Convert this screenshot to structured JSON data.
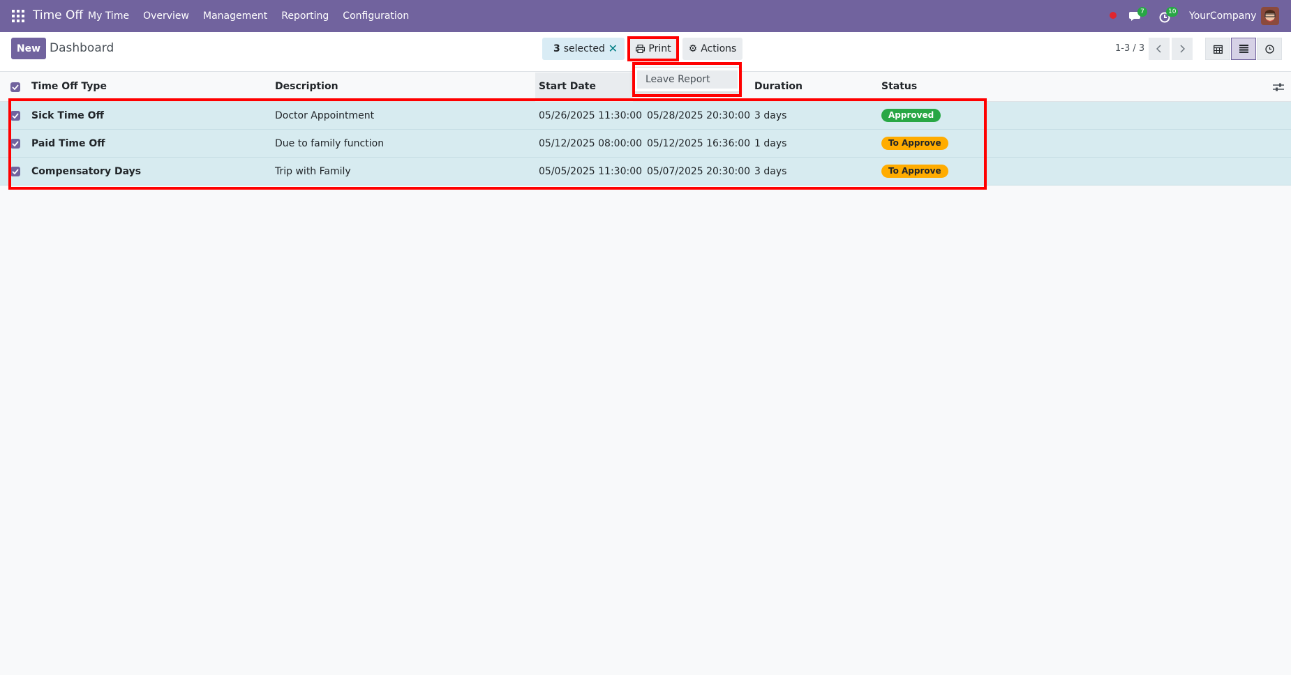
{
  "navbar": {
    "app_name": "Time Off",
    "menu": [
      "My Time",
      "Overview",
      "Management",
      "Reporting",
      "Configuration"
    ],
    "chat_count": "7",
    "activity_count": "10",
    "company": "YourCompany",
    "bg_color": "#71639e"
  },
  "control_panel": {
    "new_label": "New",
    "title": "Dashboard",
    "selected_count": "3",
    "selected_label": "selected",
    "print_label": "Print",
    "actions_label": "Actions",
    "pager": "1-3 / 3"
  },
  "print_dropdown": {
    "items": [
      "Leave Report"
    ]
  },
  "table": {
    "columns": [
      "Time Off Type",
      "Description",
      "Start Date",
      "Duration",
      "Status"
    ],
    "rows": [
      {
        "type": "Sick Time Off",
        "description": "Doctor Appointment",
        "start": "05/26/2025 11:30:00",
        "end": "05/28/2025 20:30:00",
        "duration": "3 days",
        "status": "Approved",
        "status_color": "#28a745"
      },
      {
        "type": "Paid Time Off",
        "description": "Due to family function",
        "start": "05/12/2025 08:00:00",
        "end": "05/12/2025 16:36:00",
        "duration": "1 days",
        "status": "To Approve",
        "status_color": "#ffac00"
      },
      {
        "type": "Compensatory Days",
        "description": "Trip with Family",
        "start": "05/05/2025 11:30:00",
        "end": "05/07/2025 20:30:00",
        "duration": "3 days",
        "status": "To Approve",
        "status_color": "#ffac00"
      }
    ]
  }
}
